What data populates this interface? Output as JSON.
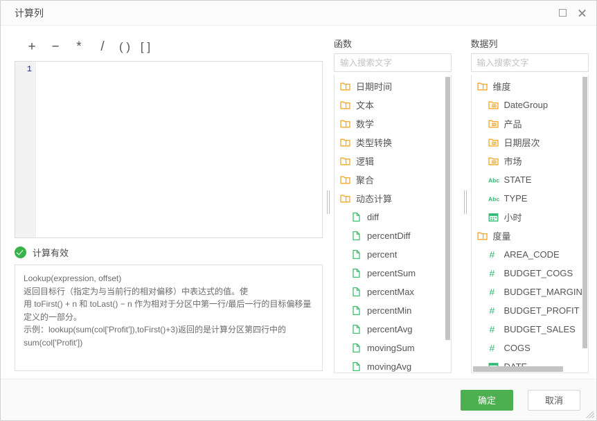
{
  "window": {
    "title": "计算列",
    "maximize_icon": "maximize-icon",
    "close_icon": "close-icon"
  },
  "editor": {
    "operators": [
      "+",
      "−",
      "*",
      "/",
      "( )",
      "[ ]"
    ],
    "line_number": "1",
    "code": ""
  },
  "status": {
    "icon": "check-circle-icon",
    "text": "计算有效"
  },
  "description": {
    "text": "Lookup(expression, offset)\n返回目标行（指定为与当前行的相对偏移）中表达式的值。使\n用 toFirst() + n 和 toLast() − n 作为相对于分区中第一行/最后一行的目标偏移量\n定义的一部分。\n示例：lookup(sum(col['Profit']),toFirst()+3)返回的是计算分区第四行中的\nsum(col['Profit'])"
  },
  "functions_panel": {
    "label": "函数",
    "search_placeholder": "输入搜索文字",
    "search_value": "",
    "items": [
      {
        "label": "日期时间",
        "icon": "folder-icon",
        "level": 0
      },
      {
        "label": "文本",
        "icon": "folder-icon",
        "level": 0
      },
      {
        "label": "数学",
        "icon": "folder-icon",
        "level": 0
      },
      {
        "label": "类型转换",
        "icon": "folder-icon",
        "level": 0
      },
      {
        "label": "逻辑",
        "icon": "folder-icon",
        "level": 0
      },
      {
        "label": "聚合",
        "icon": "folder-icon",
        "level": 0
      },
      {
        "label": "动态计算",
        "icon": "folder-open-icon",
        "level": 0
      },
      {
        "label": "diff",
        "icon": "file-icon",
        "level": 1
      },
      {
        "label": "percentDiff",
        "icon": "file-icon",
        "level": 1
      },
      {
        "label": "percent",
        "icon": "file-icon",
        "level": 1
      },
      {
        "label": "percentSum",
        "icon": "file-icon",
        "level": 1
      },
      {
        "label": "percentMax",
        "icon": "file-icon",
        "level": 1
      },
      {
        "label": "percentMin",
        "icon": "file-icon",
        "level": 1
      },
      {
        "label": "percentAvg",
        "icon": "file-icon",
        "level": 1
      },
      {
        "label": "movingSum",
        "icon": "file-icon",
        "level": 1
      },
      {
        "label": "movingAvg",
        "icon": "file-icon",
        "level": 1
      }
    ]
  },
  "data_columns_panel": {
    "label": "数据列",
    "search_placeholder": "输入搜索文字",
    "search_value": "",
    "items": [
      {
        "label": "维度",
        "icon": "folder-icon",
        "level": 0
      },
      {
        "label": "DateGroup",
        "icon": "hierarchy-icon",
        "level": 1
      },
      {
        "label": "产品",
        "icon": "hierarchy-icon",
        "level": 1
      },
      {
        "label": "日期层次",
        "icon": "hierarchy-icon",
        "level": 1
      },
      {
        "label": "市场",
        "icon": "hierarchy-icon",
        "level": 1
      },
      {
        "label": "STATE",
        "icon": "abc-icon",
        "level": 1
      },
      {
        "label": "TYPE",
        "icon": "abc-icon",
        "level": 1
      },
      {
        "label": "小时",
        "icon": "calendar-icon",
        "level": 1
      },
      {
        "label": "度量",
        "icon": "folder-icon",
        "level": 0
      },
      {
        "label": "AREA_CODE",
        "icon": "number-icon",
        "level": 1
      },
      {
        "label": "BUDGET_COGS",
        "icon": "number-icon",
        "level": 1
      },
      {
        "label": "BUDGET_MARGIN",
        "icon": "number-icon",
        "level": 1
      },
      {
        "label": "BUDGET_PROFIT",
        "icon": "number-icon",
        "level": 1
      },
      {
        "label": "BUDGET_SALES",
        "icon": "number-icon",
        "level": 1
      },
      {
        "label": "COGS",
        "icon": "number-icon",
        "level": 1
      },
      {
        "label": "DATE",
        "icon": "calendar-icon",
        "level": 1
      }
    ]
  },
  "footer": {
    "confirm_label": "确定",
    "cancel_label": "取消"
  },
  "colors": {
    "primary": "#4cb050",
    "folder": "#f5a623",
    "file": "#3fbf6f",
    "measure": "#2eb872",
    "line_number": "#1c2b8a"
  }
}
